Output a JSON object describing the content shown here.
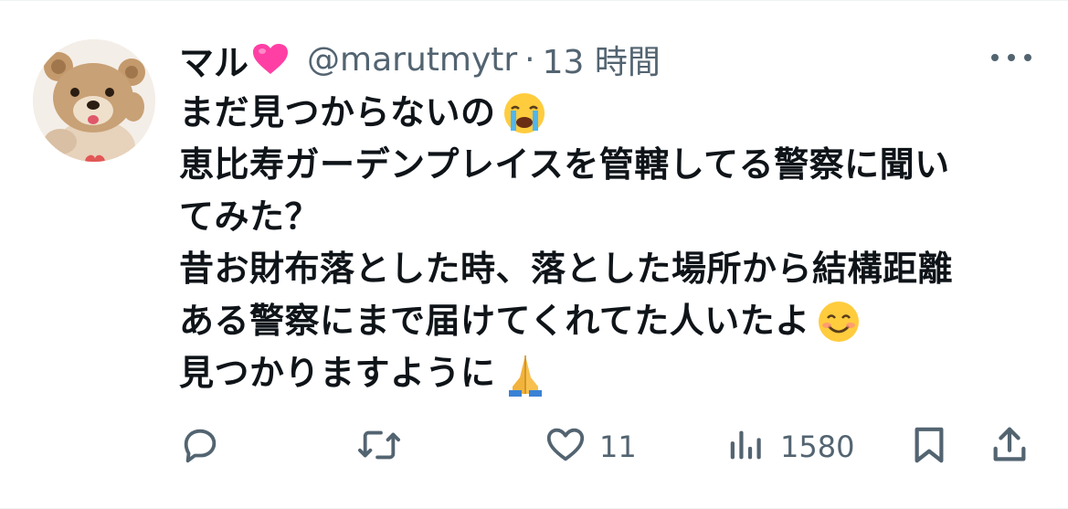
{
  "author": {
    "display_name": "マル",
    "name_emoji": "heart-emoji",
    "handle": "@marutmytr",
    "separator": "·",
    "time": "13 時間"
  },
  "tweet": {
    "lines": [
      "まだ見つからないの",
      "恵比寿ガーデンプレイスを管轄してる警察に聞い",
      "てみた？",
      "昔お財布落とした時、落とした場所から結構距離",
      "ある警察にまで届けてくれてた人いたよ",
      "見つかりますように"
    ],
    "emojis": [
      "crying-face-emoji",
      "smiling-face-emoji",
      "folded-hands-emoji"
    ]
  },
  "actions": {
    "reply_icon": "reply-icon",
    "retweet_icon": "retweet-icon",
    "like_icon": "heart-icon",
    "like_count": "11",
    "views_icon": "views-icon",
    "views_count": "1580",
    "bookmark_icon": "bookmark-icon",
    "share_icon": "share-icon"
  },
  "colors": {
    "text": "#0f1419",
    "secondary": "#536471",
    "heart_emoji": "#ff3fa4",
    "border": "#eff3f4"
  }
}
